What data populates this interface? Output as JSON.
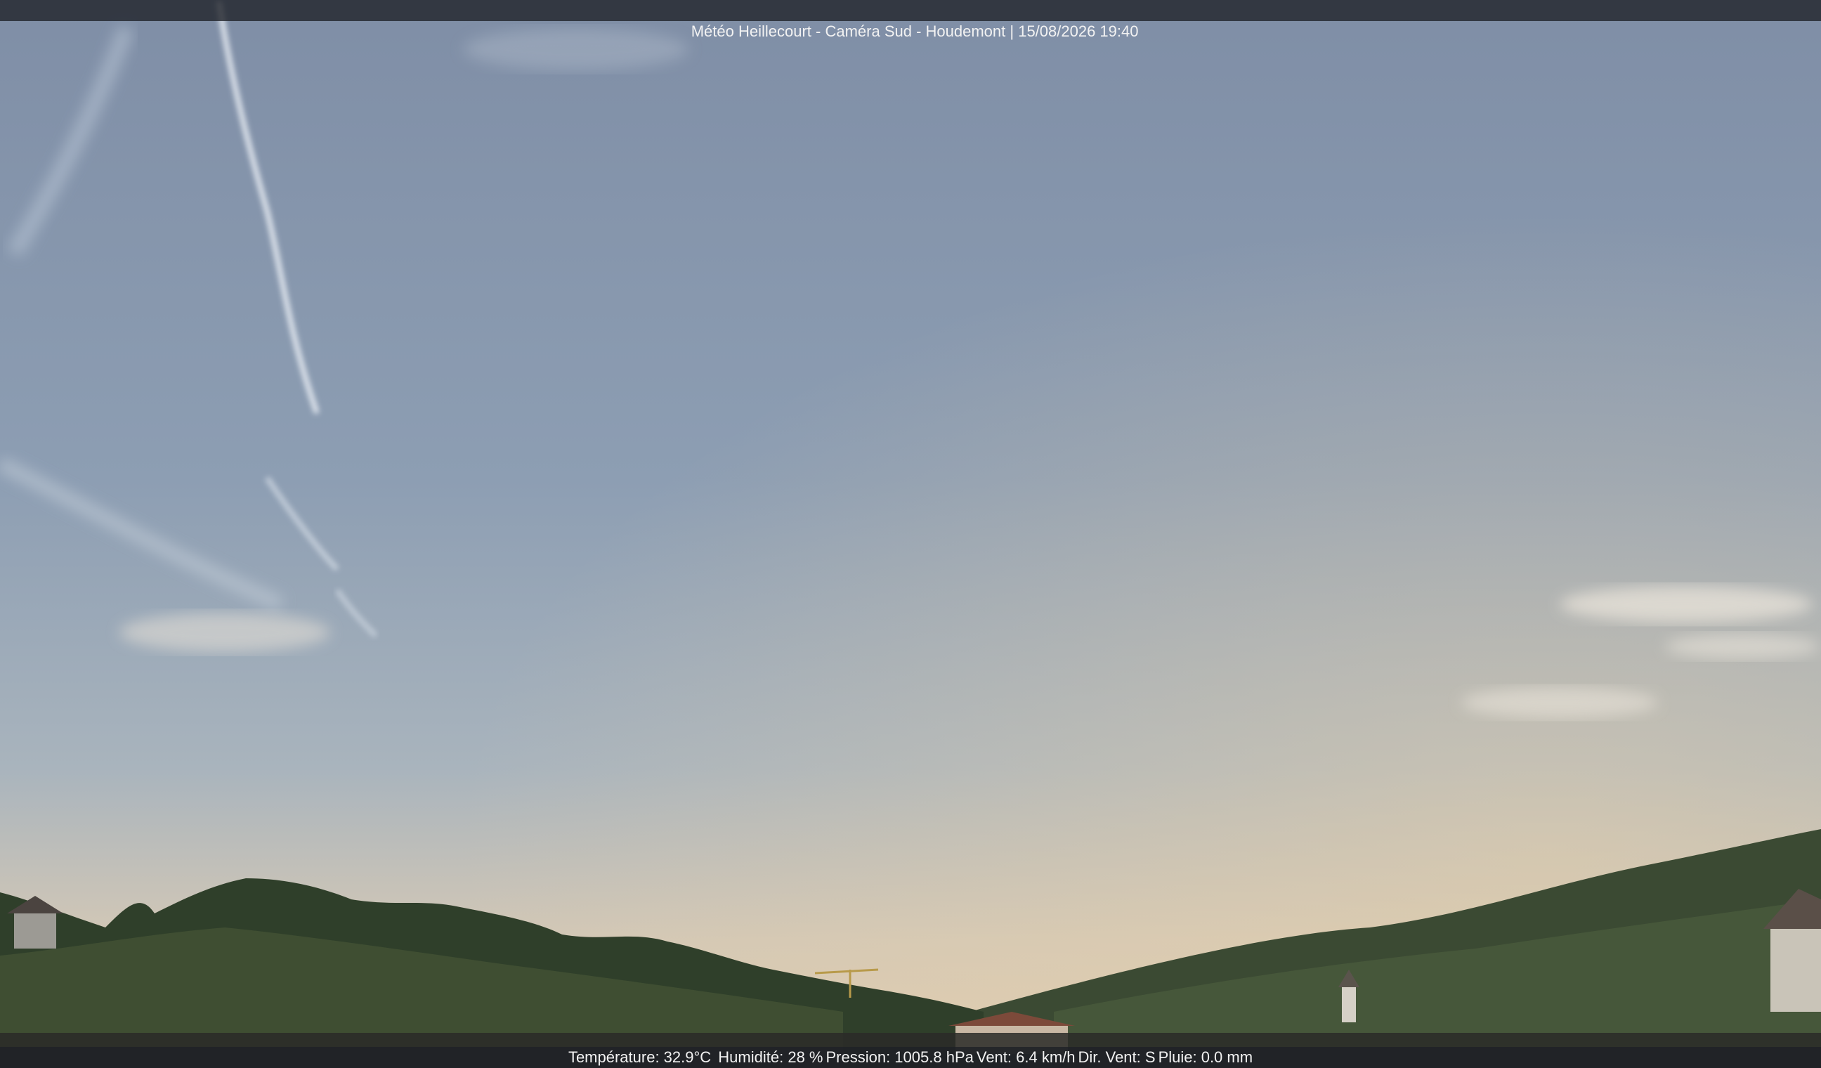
{
  "camera": {
    "title": "Météo Heillecourt - Caméra Sud - Houdemont | 15/08/2026 19:40"
  },
  "weather": {
    "temperature": "Température: 32.9°C",
    "humidity": "Humidité: 28 %",
    "pressure": "Pression: 1005.8 hPa",
    "wind_speed": "Vent: 6.4 km/h",
    "wind_direction": "Dir. Vent: S",
    "rain": "Pluie: 0.0 mm"
  },
  "colors": {
    "sky_top": "#8797ad",
    "sky_horizon": "#d9c9b2",
    "vegetation": "#2f3f2a",
    "overlay": "#1e2026"
  }
}
